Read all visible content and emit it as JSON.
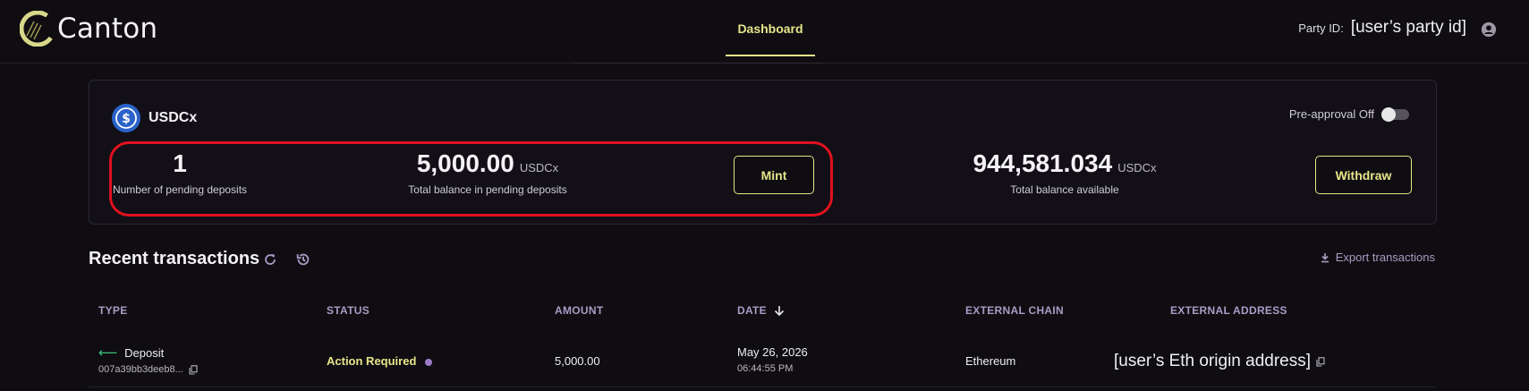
{
  "header": {
    "app_name": "Canton",
    "nav_tab": "Dashboard",
    "party_label": "Party ID:",
    "party_value": "[user’s party id]"
  },
  "card": {
    "token_name": "USDCx",
    "preapproval_label": "Pre-approval Off",
    "pending_count": "1",
    "pending_count_label": "Number of pending deposits",
    "pending_balance": "5,000.00",
    "pending_balance_unit": "USDCx",
    "pending_balance_label": "Total balance in pending deposits",
    "mint_label": "Mint",
    "available_balance": "944,581.034",
    "available_unit": "USDCx",
    "available_label": "Total balance available",
    "withdraw_label": "Withdraw"
  },
  "transactions": {
    "title": "Recent transactions",
    "export_label": "Export transactions",
    "columns": [
      "TYPE",
      "STATUS",
      "AMOUNT",
      "DATE",
      "EXTERNAL CHAIN",
      "EXTERNAL ADDRESS"
    ],
    "rows": [
      {
        "type": "Deposit",
        "id": "007a39bb3deeb8...",
        "status": "Action Required",
        "amount": "5,000.00",
        "date": "May 26, 2026",
        "time": "06:44:55 PM",
        "chain": "Ethereum",
        "address": "[user’s Eth origin address]"
      }
    ]
  },
  "colors": {
    "accent": "#e6e58a",
    "highlight": "#e0111f",
    "muted_purple": "#a99cc4",
    "deposit_arrow": "#3cc27a"
  }
}
